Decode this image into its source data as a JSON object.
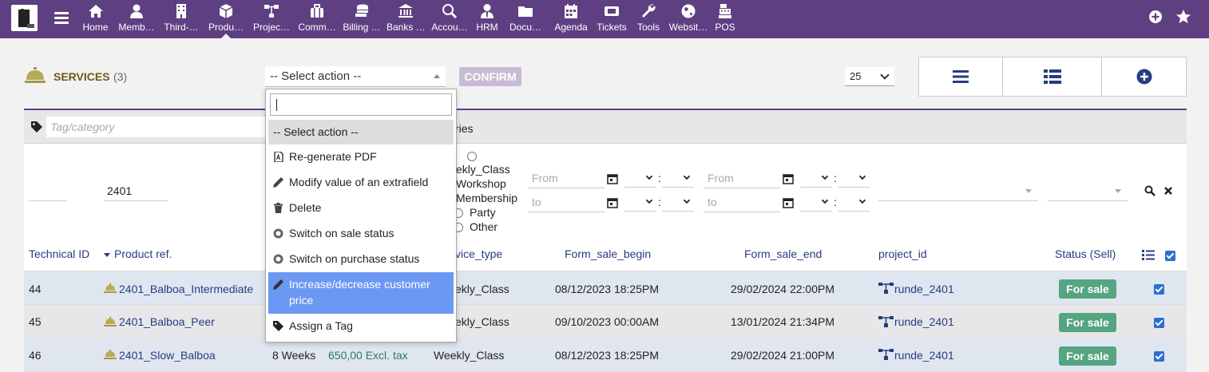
{
  "topbar": {
    "menu": [
      {
        "label": "Home",
        "icon": "home-icon"
      },
      {
        "label": "Memb…",
        "icon": "user-icon"
      },
      {
        "label": "Third-…",
        "icon": "building-icon"
      },
      {
        "label": "Produ…",
        "icon": "cube-icon",
        "active": true
      },
      {
        "label": "Projec…",
        "icon": "sitemap-icon"
      },
      {
        "label": "Comm…",
        "icon": "suitcase-icon"
      },
      {
        "label": "Billing …",
        "icon": "coins-icon"
      },
      {
        "label": "Banks …",
        "icon": "bank-icon"
      },
      {
        "label": "Accou…",
        "icon": "search-dollar-icon"
      },
      {
        "label": "HRM",
        "icon": "user-tie-icon"
      },
      {
        "label": "Docu…",
        "icon": "folder-icon"
      },
      {
        "label": "Agenda",
        "icon": "calendar-icon"
      },
      {
        "label": "Tickets",
        "icon": "ticket-icon"
      },
      {
        "label": "Tools",
        "icon": "wrench-icon"
      },
      {
        "label": "Websit…",
        "icon": "globe-icon"
      },
      {
        "label": "POS",
        "icon": "cash-register-icon"
      }
    ]
  },
  "header": {
    "title": "SERVICES",
    "count": "(3)",
    "select_action": "-- Select action --",
    "confirm": "CONFIRM",
    "limit": "25"
  },
  "filters": {
    "tag_placeholder": "Tag/category",
    "categories_text": "ries",
    "ref_value": "2401",
    "date_from": "From",
    "date_to": "to",
    "service_types": [
      "ekly_Class",
      "Workshop",
      "Membership",
      "Party",
      "Other"
    ]
  },
  "columns": {
    "technical_id": "Technical ID",
    "product_ref": "Product ref.",
    "service_type": "vice_type",
    "form_sale_begin": "Form_sale_begin",
    "form_sale_end": "Form_sale_end",
    "project_id": "project_id",
    "status_sell": "Status (Sell)"
  },
  "rows": [
    {
      "id": "44",
      "ref": "2401_Balboa_Intermediate",
      "duration": "",
      "price": "",
      "type": "ekly_Class",
      "begin": "08/12/2023 18:25PM",
      "end": "29/02/2024 22:00PM",
      "project": "runde_2401",
      "status": "For sale"
    },
    {
      "id": "45",
      "ref": "2401_Balboa_Peer",
      "duration": "",
      "price": "",
      "type": "ekly_Class",
      "begin": "09/10/2023 00:00AM",
      "end": "13/01/2024 21:34PM",
      "project": "runde_2401",
      "status": "For sale"
    },
    {
      "id": "46",
      "ref": "2401_Slow_Balboa",
      "duration": "8 Weeks",
      "price": "650,00 Excl. tax",
      "type": "Weekly_Class",
      "begin": "08/12/2023 18:25PM",
      "end": "29/02/2024 21:00PM",
      "project": "runde_2401",
      "status": "For sale"
    }
  ],
  "dropdown": {
    "items": [
      {
        "label": "-- Select action --",
        "icon": "",
        "state": "selected"
      },
      {
        "label": "Re-generate PDF",
        "icon": "pdf-icon"
      },
      {
        "label": "Modify value of an extrafield",
        "icon": "pencil-icon"
      },
      {
        "label": "Delete",
        "icon": "trash-icon"
      },
      {
        "label": "Switch on sale status",
        "icon": "toggle-icon"
      },
      {
        "label": "Switch on purchase status",
        "icon": "toggle-icon"
      },
      {
        "label": "Increase/decrease customer",
        "label2": "price",
        "icon": "pencil-icon",
        "state": "highlighted"
      },
      {
        "label": "Assign a Tag",
        "icon": "tag-icon"
      }
    ]
  },
  "colors": {
    "topbar": "#5e3f82",
    "link": "#263c7f",
    "badge": "#55a580",
    "highlight": "#6b98f2"
  }
}
